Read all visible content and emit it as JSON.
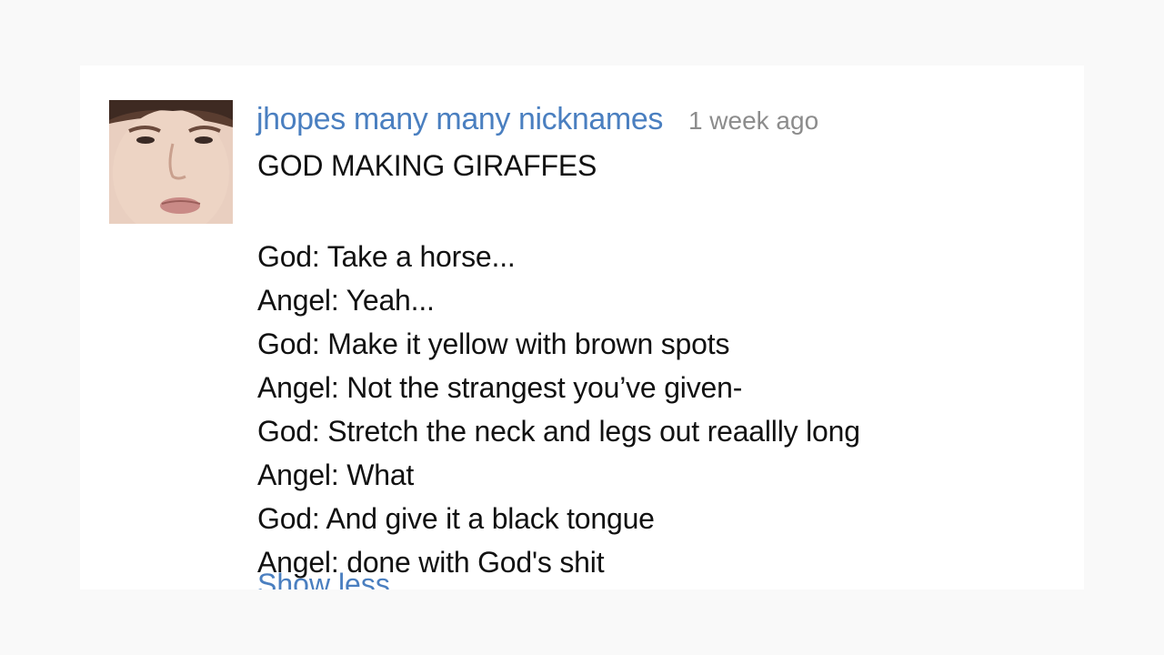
{
  "comment": {
    "author": "jhopes many many nicknames",
    "timestamp": "1 week ago",
    "title": "GOD MAKING GIRAFFES",
    "lines": [
      "God: Take a horse...",
      "Angel: Yeah...",
      "God: Make it yellow with brown spots",
      "Angel: Not the strangest you’ve given-",
      "God: Stretch the neck and legs out reaallly long",
      "Angel: What",
      "God: And give it a black tongue",
      "Angel: done with God's shit"
    ],
    "show_less": "Show less",
    "avatar_icon": "avatar-photo"
  },
  "colors": {
    "author_link": "#4a7fc0",
    "timestamp": "#8c8c8c",
    "text": "#111111",
    "card_bg": "#ffffff",
    "page_bg": "#f9f9f9"
  }
}
